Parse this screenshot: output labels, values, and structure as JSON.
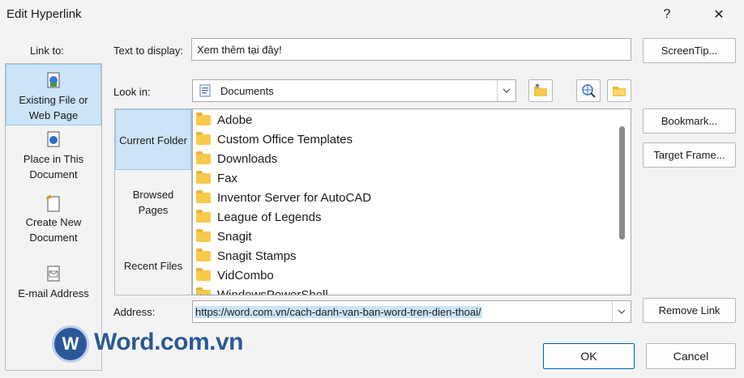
{
  "window": {
    "title": "Edit Hyperlink",
    "help": "?",
    "close": "✕"
  },
  "link_to": {
    "label": "Link to:",
    "items": [
      {
        "line1": "Existing File or",
        "line2": "Web Page"
      },
      {
        "line1": "Place in This",
        "line2": "Document"
      },
      {
        "line1": "Create New",
        "line2": "Document"
      },
      {
        "line1": "E-mail Address",
        "line2": ""
      }
    ]
  },
  "text_to_display": {
    "label": "Text to display:",
    "value": "Xem thêm tại đây!"
  },
  "screentip_label": "ScreenTip...",
  "look_in": {
    "label": "Look in:",
    "value": "Documents"
  },
  "nav": {
    "current_folder": "Current Folder",
    "browsed_line1": "Browsed",
    "browsed_line2": "Pages",
    "recent_files": "Recent Files"
  },
  "folders": [
    "Adobe",
    "Custom Office Templates",
    "Downloads",
    "Fax",
    "Inventor Server for AutoCAD",
    "League of Legends",
    "Snagit",
    "Snagit Stamps",
    "VidCombo",
    "WindowsPowerShell"
  ],
  "buttons": {
    "bookmark": "Bookmark...",
    "target_frame": "Target Frame...",
    "remove_link": "Remove Link",
    "ok": "OK",
    "cancel": "Cancel"
  },
  "address": {
    "label": "Address:",
    "value": "https://word.com.vn/cach-danh-van-ban-word-tren-dien-thoai/"
  },
  "watermark": {
    "text": "Word.com.vn",
    "badge": "W"
  },
  "colors": {
    "accent": "#0067c0",
    "selection": "#cce4f7",
    "folder": "#f8c94a"
  }
}
